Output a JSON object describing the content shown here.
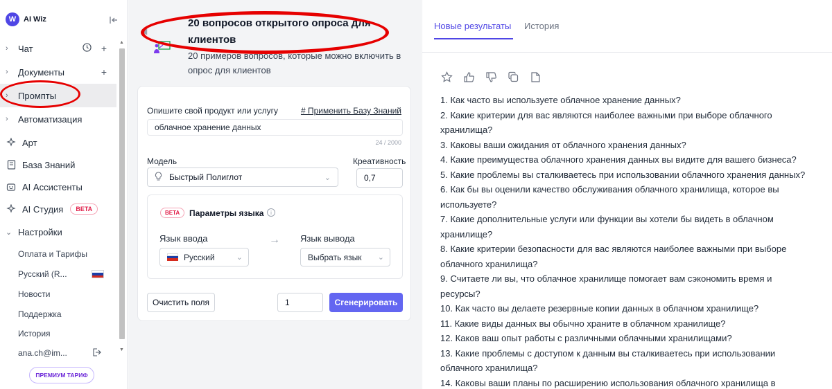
{
  "app": {
    "brand": "AI Wiz",
    "logo_letter": "W"
  },
  "sidebar": {
    "items": [
      {
        "label": "Чат"
      },
      {
        "label": "Документы"
      },
      {
        "label": "Промпты"
      },
      {
        "label": "Автоматизация"
      },
      {
        "label": "Арт"
      },
      {
        "label": "База Знаний"
      },
      {
        "label": "AI Ассистенты"
      },
      {
        "label": "AI Студия",
        "badge": "BETA"
      },
      {
        "label": "Настройки"
      }
    ],
    "settings_items": [
      {
        "label": "Оплата и Тарифы"
      },
      {
        "label": "Русский (R..."
      },
      {
        "label": "Новости"
      },
      {
        "label": "Поддержка"
      },
      {
        "label": "История"
      },
      {
        "label": "ana.ch@im..."
      }
    ],
    "premium_label": "ПРЕМИУМ ТАРИФ"
  },
  "template": {
    "title": "20 вопросов открытого опроса для клиентов",
    "description": "20 примеров вопросов, которые можно включить в опрос для клиентов"
  },
  "form": {
    "product_label": "Опишите свой продукт или услугу",
    "kb_link": "# Применить Базу Знаний",
    "product_value": "облачное хранение данных",
    "counter": "24 / 2000",
    "model_label": "Модель",
    "model_value": "Быстрый Полиглот",
    "creativity_label": "Креативность",
    "creativity_value": "0,7",
    "lang_badge": "BETA",
    "lang_title": "Параметры языка",
    "input_lang_label": "Язык ввода",
    "input_lang_value": "Русский",
    "output_lang_label": "Язык вывода",
    "output_lang_value": "Выбрать язык",
    "clear_label": "Очистить поля",
    "count_value": "1",
    "generate_label": "Сгенерировать"
  },
  "results": {
    "tabs": [
      {
        "label": "Новые результаты"
      },
      {
        "label": "История"
      }
    ],
    "lines": [
      "1. Как часто вы используете облачное хранение данных?",
      "2. Какие критерии для вас являются наиболее важными при выборе облачного",
      "хранилища?",
      "3. Каковы ваши ожидания от облачного хранения данных?",
      "4. Какие преимущества облачного хранения данных вы видите для вашего бизнеса?",
      "5. Какие проблемы вы сталкиваетесь при использовании облачного хранения данных?",
      "6. Как бы вы оценили качество обслуживания облачного хранилища, которое вы",
      "используете?",
      "7. Какие дополнительные услуги или функции вы хотели бы видеть в облачном",
      "хранилище?",
      "8. Какие критерии безопасности для вас являются наиболее важными при выборе",
      "облачного хранилища?",
      "9. Считаете ли вы, что облачное хранилище помогает вам сэкономить время и",
      "ресурсы?",
      "10. Как часто вы делаете резервные копии данных в облачном хранилище?",
      "11. Какие виды данных вы обычно храните в облачном хранилище?",
      "12. Каков ваш опыт работы с различными облачными хранилищами?",
      "13. Какие проблемы с доступом к данным вы сталкиваетесь при использовании",
      "облачного хранилища?",
      "14. Каковы ваши планы по расширению использования облачного хранилища в"
    ]
  },
  "colors": {
    "accent": "#4f46e5",
    "button": "#6366f1",
    "highlight": "#e60000"
  },
  "icons": [
    "chevron-right-icon",
    "clock-icon",
    "plus-icon",
    "sparkle-icon",
    "book-icon",
    "robot-icon",
    "collapse-icon",
    "bulb-icon",
    "star-icon",
    "thumb-up-icon",
    "thumb-down-icon",
    "copy-icon",
    "document-icon",
    "logout-icon",
    "info-icon",
    "arrow-right-icon"
  ]
}
